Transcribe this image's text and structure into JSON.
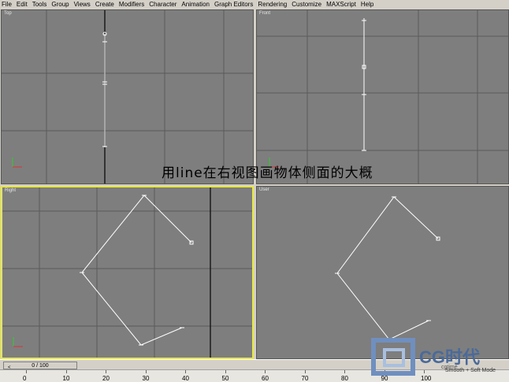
{
  "menu": [
    "File",
    "Edit",
    "Tools",
    "Group",
    "Views",
    "Create",
    "Modifiers",
    "Character",
    "Animation",
    "Graph Editors",
    "Rendering",
    "Customize",
    "MAXScript",
    "Help"
  ],
  "viewports": {
    "top": {
      "label": "Top"
    },
    "front": {
      "label": "Front"
    },
    "right": {
      "label": "Right"
    },
    "user": {
      "label": "User"
    }
  },
  "caption": "用line在右视图画物体侧面的大概",
  "timeline": {
    "frame": "0 / 100",
    "prev": "<"
  },
  "ruler": {
    "ticks": [
      "0",
      "10",
      "20",
      "30",
      "40",
      "50",
      "60",
      "70",
      "80",
      "90",
      "100"
    ]
  },
  "logo": {
    "text": "CG时代",
    "url_fragment": "cgtime"
  },
  "status": "Smooth + Soft Mode",
  "colors": {
    "viewport_bg": "#7e7e7e",
    "active_border": "#e8e840",
    "grid": "#5a5a5a",
    "line": "#ffffff"
  }
}
